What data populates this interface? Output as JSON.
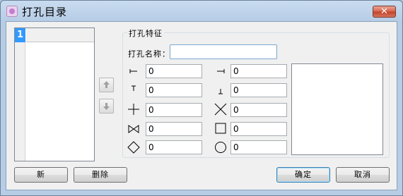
{
  "window": {
    "title": "打孔目录",
    "close_label": "✕"
  },
  "list": {
    "items": [
      {
        "number": "1",
        "name": ""
      }
    ]
  },
  "move_buttons": {
    "up_icon": "arrow-up-icon",
    "down_icon": "arrow-down-icon"
  },
  "group": {
    "title": "打孔特征",
    "name_label": "打孔名称：",
    "name_value": "",
    "symbols": {
      "left_tee": "0",
      "right_tee": "0",
      "top_tee": "0",
      "bottom_tee": "0",
      "cross": "0",
      "x_cross": "0",
      "bowtie": "0",
      "square": "0",
      "diamond": "0",
      "circle": "0"
    }
  },
  "buttons": {
    "new": "新",
    "delete": "删除",
    "ok": "确定",
    "cancel": "取消"
  }
}
